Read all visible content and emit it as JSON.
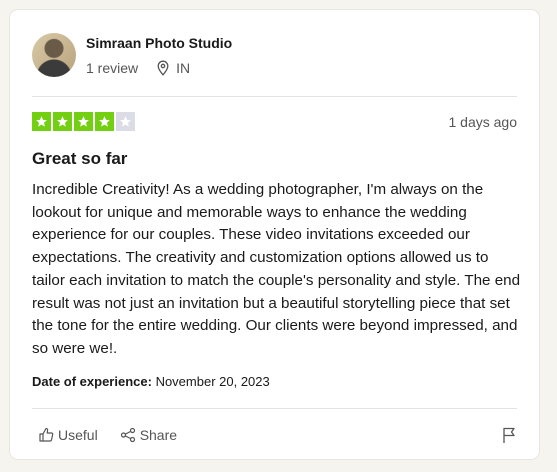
{
  "reviewer": {
    "name": "Simraan Photo Studio",
    "reviews": "1 review",
    "country": "IN"
  },
  "rating": {
    "stars": 4,
    "max": 5,
    "color_filled": "#73cf11",
    "color_empty": "#dcdce6"
  },
  "review": {
    "date_ago": "1 days ago",
    "title": "Great so far",
    "body": "Incredible Creativity! As a wedding photographer, I'm always on the lookout for unique and memorable ways to enhance the wedding experience for our couples. These video invitations exceeded our expectations. The creativity and customization options allowed us to tailor each invitation to match the couple's personality and style. The end result was not just an invitation but a beautiful storytelling piece that set the tone for the entire wedding. Our clients were beyond impressed, and so were we!.",
    "experience_label": "Date of experience:",
    "experience_date": "November 20, 2023"
  },
  "actions": {
    "useful": "Useful",
    "share": "Share"
  },
  "icons": {
    "location": "location-pin-icon",
    "useful": "thumbs-up-icon",
    "share": "share-icon",
    "report": "flag-icon"
  }
}
